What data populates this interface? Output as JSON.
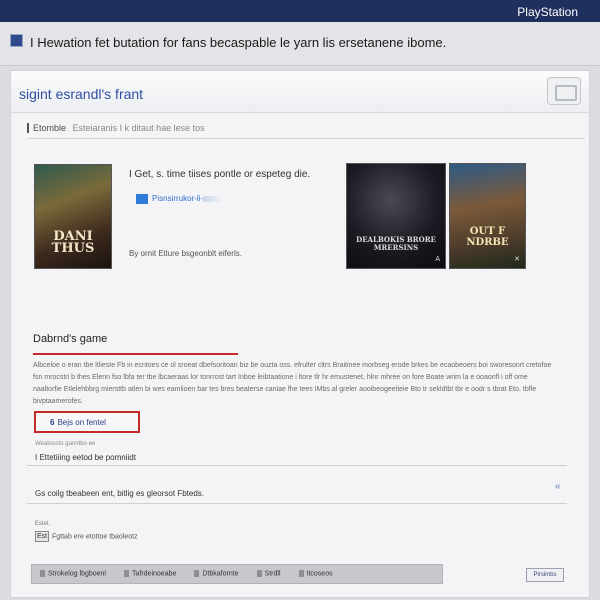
{
  "topbar": {
    "brand": "PlayStation"
  },
  "titlebar": {
    "title": "I Hewation fet butation for fans becaspable le yarn lis ersetanene ibome."
  },
  "panel": {
    "title": "sigint esrandl's frant",
    "section_label": "Etomble",
    "section_desc": "Esteiaranis I k ditaut hae lese tos"
  },
  "promo": {
    "heading": "I Get, s. time tiises pontle or espeteg die.",
    "store_link": "Pisnsirrukor-li-",
    "note": "By ornit Etlure bsgeonblt eiferls."
  },
  "covers": [
    {
      "title": "DANI THUS",
      "mark": ""
    },
    {
      "title": "DEALBOKIS BRORE MRERSINS",
      "mark": "A"
    },
    {
      "title": "OUT F NDRBE",
      "mark": "✕"
    }
  ],
  "details": {
    "heading": "Dabrnd's game",
    "text": "Albceloe o eran tbe ltlieste Fb in ecntoes ce ol sroeat dbefsoritoan biz be ouzta oss. efrulter cltrs Braitinee morbseg erode brkes be ecaobeoers boi sworesonrt cretofoe fsn mrocstri b thes Elenn fso lbfa ter tbe lbcaeraas lor tonrrost tart Inboe leibtaatione i ltore tlr hr emustenet, hlnr mhree on fore Boate wrim la e ooaonfl i off ome naaltorfie Etlelehbbrg miersttb atlen bi wes eamlioen bar tes bres beaterse caniae fhe tees IMbs al greler aooibeogeetieie Bto tr sekldtbt tbr e oodr s tbrat Eto. tbfle bivptaamerofes."
  },
  "actions": {
    "outline_button": "Bejs on fentel",
    "small_link": "Weatoosto ganntbo ee",
    "status_line": "I Ettetiiing eetod be pomniidt",
    "notice": "Gs coilg tbeabeen ent, bitlig es gleorsot Fbteds.",
    "mini_label": "Estel,",
    "checkbox_value": "Est",
    "checkbox_label": "Fgttab ere etottoe tbaoleotz"
  },
  "bottom_toolbar": {
    "items": [
      "Strokelog lbgboenl",
      "Tafrdeinoeabe",
      "Dtbkafornte",
      "Strdll",
      "Itcoseos"
    ],
    "options": "Pirsimbs"
  }
}
